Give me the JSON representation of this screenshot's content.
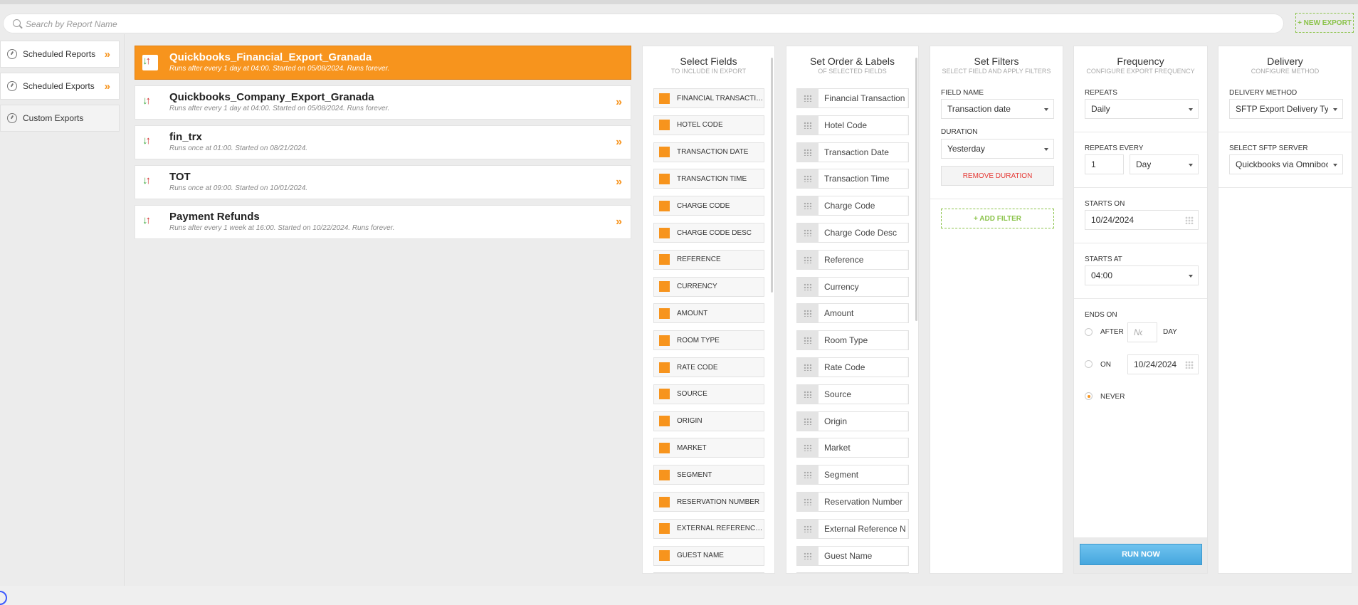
{
  "search": {
    "placeholder": "Search by Report Name",
    "new_export_label": "+ NEW EXPORT"
  },
  "nav": [
    {
      "label": "Scheduled Reports",
      "chev": "»"
    },
    {
      "label": "Scheduled Exports",
      "chev": "»"
    },
    {
      "label": "Custom Exports",
      "chev": ""
    }
  ],
  "reports": [
    {
      "name": "Quickbooks_Financial_Export_Granada",
      "sub": "Runs after every 1 day at 04:00. Started on 05/08/2024. Runs forever.",
      "selected": true
    },
    {
      "name": "Quickbooks_Company_Export_Granada",
      "sub": "Runs after every 1 day at 04:00. Started on 05/08/2024. Runs forever.",
      "selected": false
    },
    {
      "name": "fin_trx",
      "sub": "Runs once at 01:00. Started on 08/21/2024.",
      "selected": false
    },
    {
      "name": "TOT",
      "sub": "Runs once at 09:00. Started on 10/01/2024.",
      "selected": false
    },
    {
      "name": "Payment Refunds",
      "sub": "Runs after every 1 week at 16:00. Started on 10/22/2024. Runs forever.",
      "selected": false
    }
  ],
  "select_fields": {
    "title": "Select Fields",
    "subtitle": "TO INCLUDE IN EXPORT",
    "fields": [
      "FINANCIAL TRANSACTION ID",
      "HOTEL CODE",
      "TRANSACTION DATE",
      "TRANSACTION TIME",
      "CHARGE CODE",
      "CHARGE CODE DESC",
      "REFERENCE",
      "CURRENCY",
      "AMOUNT",
      "ROOM TYPE",
      "RATE CODE",
      "SOURCE",
      "ORIGIN",
      "MARKET",
      "SEGMENT",
      "RESERVATION NUMBER",
      "EXTERNAL REFERENCE NU...",
      "GUEST NAME",
      ""
    ]
  },
  "order_labels": {
    "title": "Set Order & Labels",
    "subtitle": "OF SELECTED FIELDS",
    "rows": [
      "Financial Transaction I",
      "Hotel Code",
      "Transaction Date",
      "Transaction Time",
      "Charge Code",
      "Charge Code Desc",
      "Reference",
      "Currency",
      "Amount",
      "Room Type",
      "Rate Code",
      "Source",
      "Origin",
      "Market",
      "Segment",
      "Reservation Number",
      "External Reference Nu",
      "Guest Name",
      ""
    ]
  },
  "filters": {
    "title": "Set Filters",
    "subtitle": "SELECT FIELD AND APPLY FILTERS",
    "field_name_label": "FIELD NAME",
    "field_name_value": "Transaction date",
    "duration_label": "DURATION",
    "duration_value": "Yesterday",
    "remove_duration": "REMOVE DURATION",
    "add_filter": "+ ADD FILTER"
  },
  "frequency": {
    "title": "Frequency",
    "subtitle": "CONFIGURE EXPORT FREQUENCY",
    "repeats_label": "REPEATS",
    "repeats_value": "Daily",
    "repeats_every_label": "REPEATS EVERY",
    "repeats_every_value": "1",
    "repeats_every_unit": "Day",
    "starts_on_label": "STARTS ON",
    "starts_on_value": "10/24/2024",
    "starts_at_label": "STARTS AT",
    "starts_at_value": "04:00",
    "ends_on_label": "ENDS ON",
    "after_label": "AFTER",
    "after_placeholder": "No.",
    "day_label": "DAY",
    "on_label": "ON",
    "on_value": "10/24/2024",
    "never_label": "NEVER",
    "selected_end": "never",
    "run_now": "RUN NOW"
  },
  "delivery": {
    "title": "Delivery",
    "subtitle": "CONFIGURE METHOD",
    "method_label": "DELIVERY METHOD",
    "method_value": "SFTP Export Delivery Type",
    "server_label": "SELECT SFTP SERVER",
    "server_value": "Quickbooks via Omniboos"
  },
  "colors": {
    "accent": "#f7941d",
    "add": "#8bc34a",
    "remove": "#e53935",
    "run": "#4fb3e6"
  },
  "icons": {
    "search": "search-icon",
    "nav": "gauge-icon",
    "report": "import-export-arrows-icon",
    "chevron": "double-chevron-right-icon",
    "drag": "drag-handle-icon",
    "calendar": "calendar-icon",
    "caret": "caret-down-icon"
  }
}
